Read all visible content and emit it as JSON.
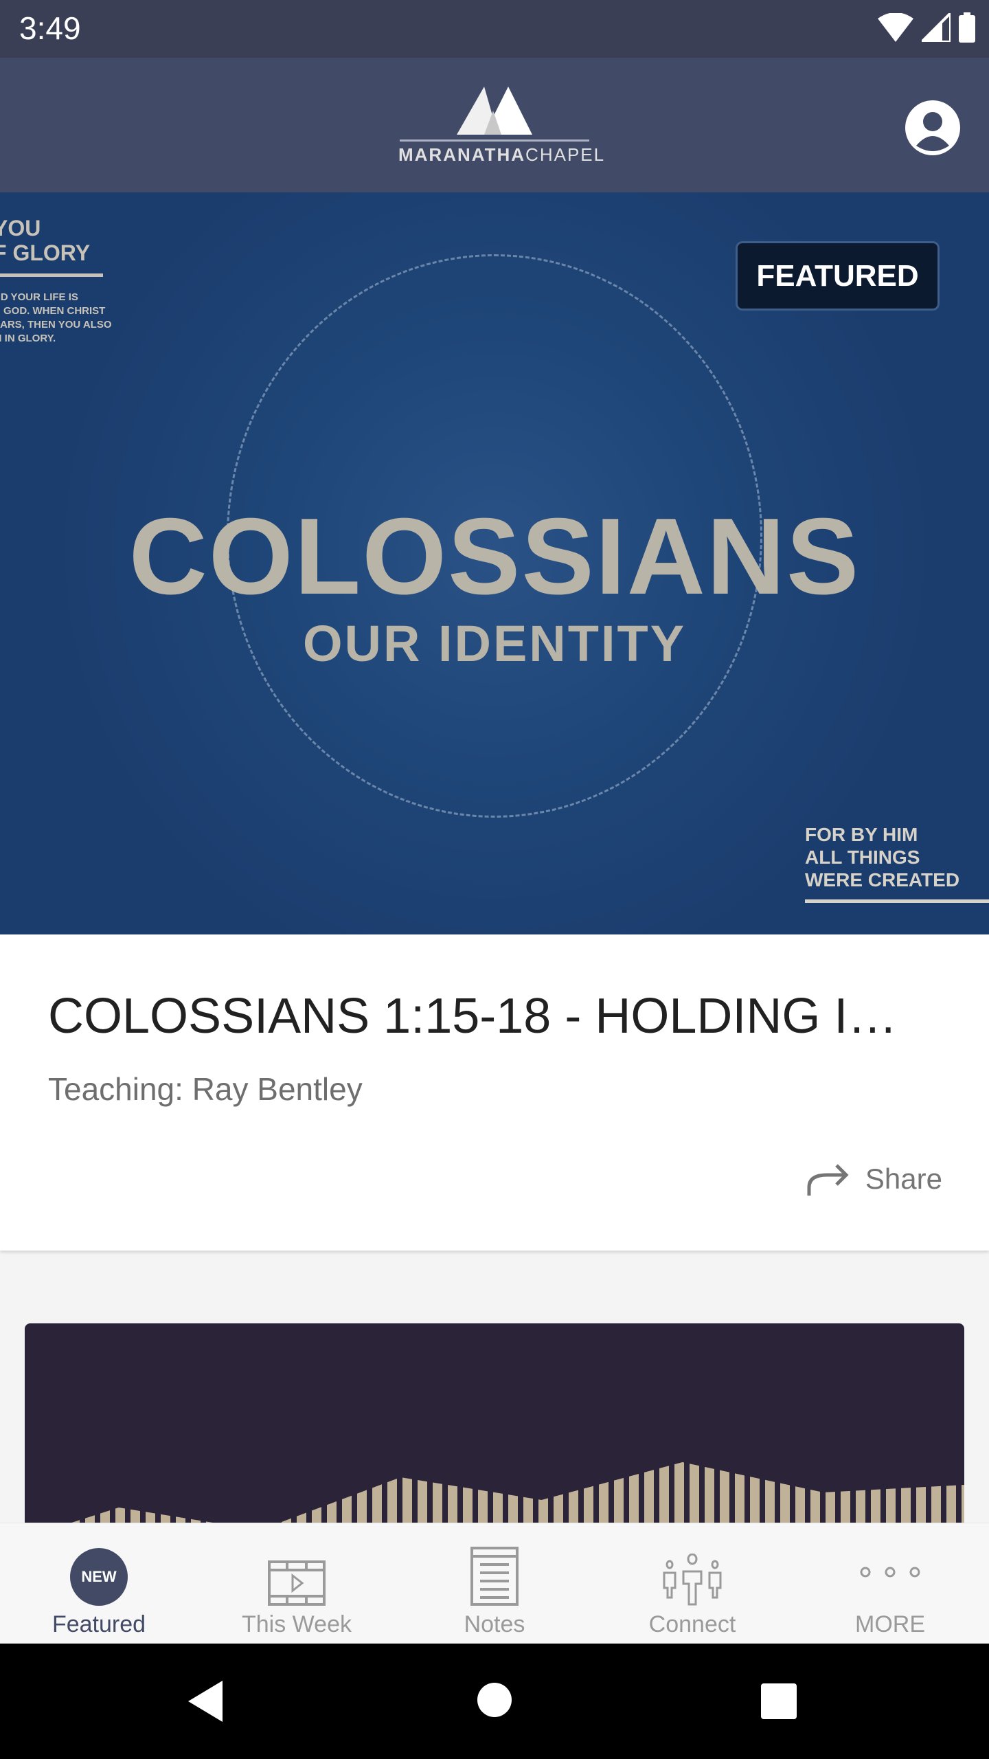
{
  "status_bar": {
    "time": "3:49",
    "icons": [
      "wifi-icon",
      "signal-icon",
      "battery-icon"
    ]
  },
  "header": {
    "logo_text_bold": "MARANATHA",
    "logo_text_light": "CHAPEL",
    "profile_icon": "account-circle-icon"
  },
  "hero": {
    "badge": "FEATURED",
    "artwork_title": "COLOSSIANS",
    "artwork_subtitle": "OUR IDENTITY",
    "left_text_lines": [
      "YOU",
      "F GLORY"
    ],
    "left_small_lines": [
      "ND YOUR LIFE IS",
      "N GOD. WHEN CHRIST",
      "EARS, THEN YOU ALSO",
      "M IN GLORY."
    ],
    "right_text_lines": [
      "FOR BY HIM",
      "ALL THINGS",
      "WERE CREATED"
    ]
  },
  "featured": {
    "title": "COLOSSIANS 1:15-18 - HOLDING I…",
    "teacher": "Teaching: Ray Bentley",
    "share_label": "Share"
  },
  "bottom_nav": {
    "items": [
      {
        "label": "Featured",
        "icon": "new-badge-icon",
        "badge": "NEW",
        "active": true
      },
      {
        "label": "This Week",
        "icon": "video-film-icon"
      },
      {
        "label": "Notes",
        "icon": "notepad-icon"
      },
      {
        "label": "Connect",
        "icon": "people-icon"
      },
      {
        "label": "MORE",
        "icon": "more-dots-icon"
      }
    ]
  },
  "colors": {
    "header": "#414a66",
    "status_bar": "#3a3f55",
    "accent": "#434a66",
    "hero_bg": "#1d3f70"
  }
}
